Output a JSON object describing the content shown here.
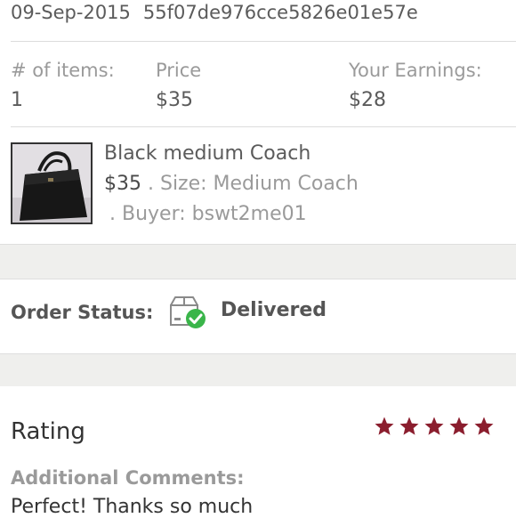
{
  "order": {
    "date": "09-Sep-2015",
    "order_id": "55f07de976cce5826e01e57e"
  },
  "summary": {
    "items_label": "# of items:",
    "items_value": "1",
    "price_label": "Price",
    "price_value": "$35",
    "earnings_label": "Your Earnings:",
    "earnings_value": "$28"
  },
  "item": {
    "title": "Black medium Coach",
    "price": "$35",
    "size_text": " . Size: Medium Coach",
    "buyer_text": ". Buyer: bswt2me01",
    "thumbnail_icon": "handbag-photo"
  },
  "status": {
    "label": "Order Status:",
    "value": "Delivered",
    "icon": "package-delivered-icon",
    "check_color": "#3ab54a"
  },
  "rating": {
    "label": "Rating",
    "stars": 5,
    "max_stars": 5,
    "star_color": "#8b1e2e",
    "comments_label": "Additional Comments:",
    "comments_text": "Perfect! Thanks so much"
  }
}
